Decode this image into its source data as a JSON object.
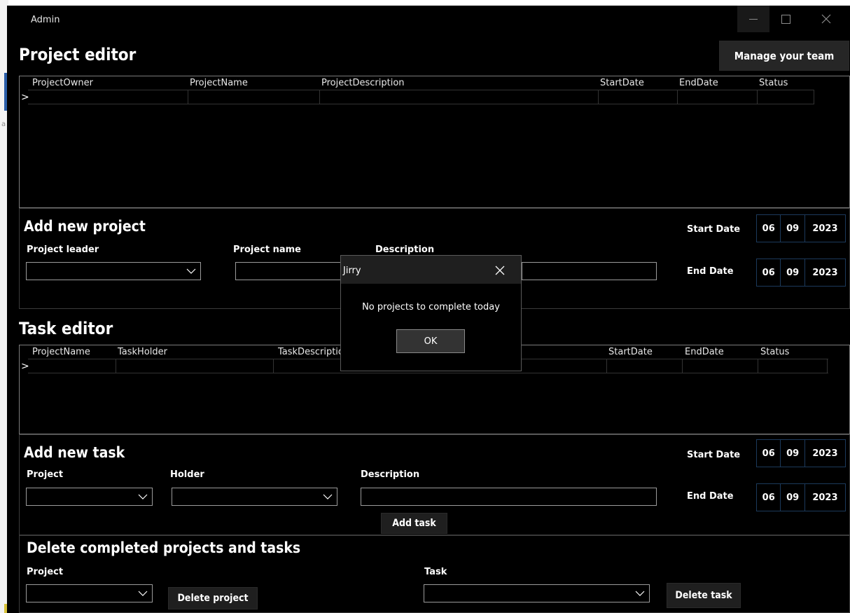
{
  "window": {
    "title": "Admin"
  },
  "header": {
    "title": "Project editor",
    "manage_team_label": "Manage your team"
  },
  "project_grid": {
    "columns": [
      "ProjectOwner",
      "ProjectName",
      "ProjectDescription",
      "StartDate",
      "EndDate",
      "Status"
    ],
    "row_indicator": ">"
  },
  "add_project": {
    "title": "Add new project",
    "leader_label": "Project leader",
    "name_label": "Project name",
    "description_label": "Description",
    "start_label": "Start Date",
    "end_label": "End Date",
    "start_date": {
      "day": "06",
      "month": "09",
      "year": "2023"
    },
    "end_date": {
      "day": "06",
      "month": "09",
      "year": "2023"
    }
  },
  "task_editor": {
    "title": "Task editor"
  },
  "task_grid": {
    "columns": [
      "ProjectName",
      "TaskHolder",
      "TaskDescription",
      "StartDate",
      "EndDate",
      "Status"
    ],
    "row_indicator": ">"
  },
  "add_task": {
    "title": "Add new task",
    "project_label": "Project",
    "holder_label": "Holder",
    "description_label": "Description",
    "start_label": "Start Date",
    "end_label": "End Date",
    "start_date": {
      "day": "06",
      "month": "09",
      "year": "2023"
    },
    "end_date": {
      "day": "06",
      "month": "09",
      "year": "2023"
    },
    "add_label": "Add task"
  },
  "delete_section": {
    "title": "Delete completed projects and tasks",
    "project_label": "Project",
    "task_label": "Task",
    "delete_project_label": "Delete project",
    "delete_task_label": "Delete task"
  },
  "dialog": {
    "title": "Jirry",
    "message": "No projects to complete today",
    "ok_label": "OK"
  }
}
